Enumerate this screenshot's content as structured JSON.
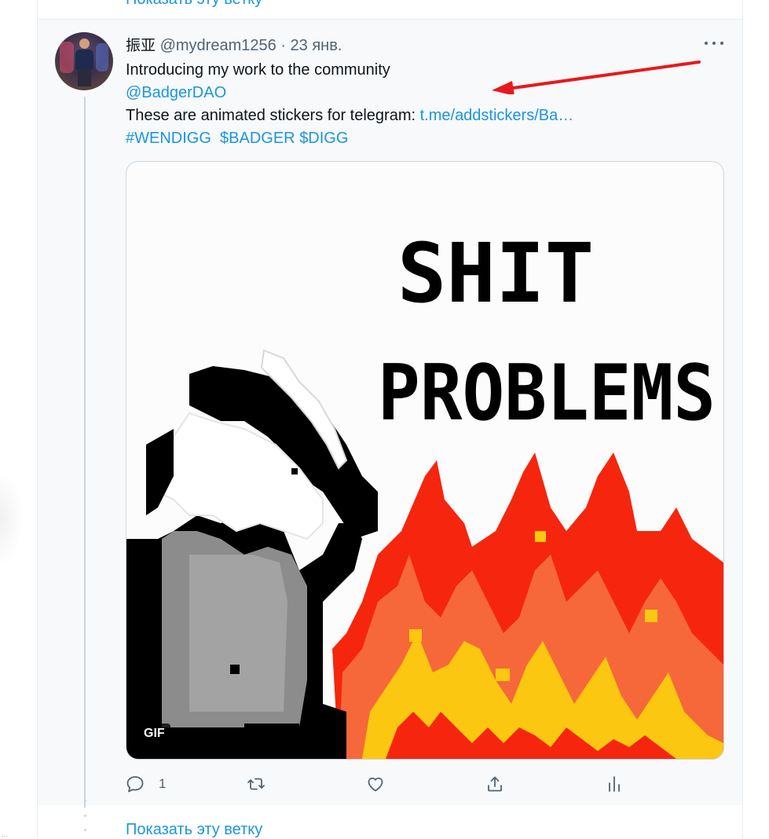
{
  "thread_top": {
    "show_thread_label": "Показать эту ветку"
  },
  "tweet": {
    "author_name": "振亚",
    "author_handle": "@mydream1256",
    "separator": "·",
    "date": "23 янв.",
    "text_line1": "Introducing my work to the community",
    "mention": "@BadgerDAO",
    "text_line3_prefix": "These are animated stickers for telegram: ",
    "link_text": "t.me/addstickers/Ba…",
    "hashtag": "#WENDIGG",
    "cashtag1": "$BADGER",
    "cashtag2": "$DIGG",
    "media": {
      "sticker_line1": "SHIT",
      "sticker_line2": "PROBLEMS",
      "badge": "GIF"
    },
    "actions": {
      "reply_count": "1",
      "icons": [
        "reply-icon",
        "retweet-icon",
        "like-icon",
        "share-icon",
        "analytics-icon"
      ]
    }
  },
  "thread_bottom": {
    "show_thread_label": "Показать эту ветку"
  },
  "colors": {
    "link": "#1b95e0",
    "secondary_text": "#536471",
    "annotation_arrow": "#e8191c",
    "fire_red": "#f5260d",
    "fire_orange": "#f6683a",
    "fire_yellow": "#fcc710"
  }
}
